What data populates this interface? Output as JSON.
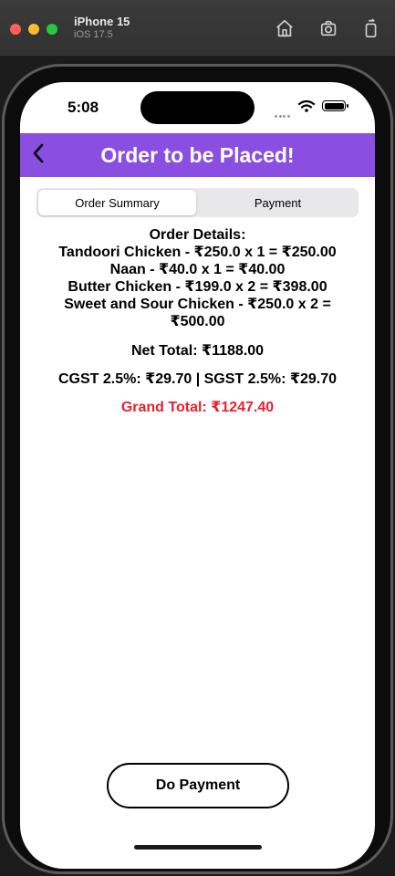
{
  "simulator": {
    "device_name": "iPhone 15",
    "os_version": "iOS 17.5",
    "toolbar_icons": [
      "home-icon",
      "screenshot-icon",
      "rotate-icon"
    ]
  },
  "status_bar": {
    "time": "5:08",
    "icons": [
      "wifi-icon",
      "battery-icon"
    ]
  },
  "header": {
    "title": "Order to be Placed!",
    "back_icon": "chevron-left-icon",
    "background_color": "#8a4fe0"
  },
  "tabs": [
    {
      "label": "Order Summary",
      "selected": true
    },
    {
      "label": "Payment",
      "selected": false
    }
  ],
  "order": {
    "heading": "Order Details:",
    "items": [
      "Tandoori Chicken - ₹250.0 x 1 = ₹250.00",
      "Naan - ₹40.0 x 1 = ₹40.00",
      "Butter Chicken - ₹199.0 x 2 = ₹398.00",
      "Sweet and Sour Chicken - ₹250.0 x 2 = ₹500.00"
    ],
    "net_total": "Net Total: ₹1188.00",
    "taxes": "CGST 2.5%: ₹29.70 | SGST 2.5%: ₹29.70",
    "grand_total": "Grand Total: ₹1247.40",
    "grand_total_color": "#e8202e"
  },
  "actions": {
    "pay_label": "Do Payment"
  }
}
